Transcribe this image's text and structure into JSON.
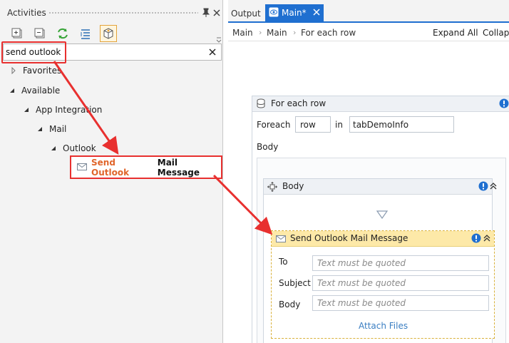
{
  "left_panel": {
    "title": "Activities",
    "search": {
      "value": "send outlook",
      "placeholder": ""
    },
    "tree": {
      "favorites": "Favorites",
      "available": "Available",
      "app_integration": "App Integration",
      "mail": "Mail",
      "outlook": "Outlook"
    },
    "result": {
      "highlight": "Send Outlook",
      "rest": "Mail Message",
      "icon": "mail-icon"
    }
  },
  "tabs": {
    "output": "Output",
    "main": "Main*"
  },
  "breadcrumb": {
    "items": [
      "Main",
      "Main",
      "For each row"
    ],
    "expand_all": "Expand All",
    "collapse_all": "Collapse All"
  },
  "designer": {
    "foreach": {
      "title": "For each row",
      "foreach_label": "Foreach",
      "var": "row",
      "in_label": "in",
      "collection": "tabDemoInfo",
      "body_label": "Body"
    },
    "body": {
      "title": "Body"
    },
    "mail": {
      "title": "Send Outlook Mail Message",
      "fields": [
        {
          "label": "To",
          "placeholder": "Text must be quoted"
        },
        {
          "label": "Subject",
          "placeholder": "Text must be quoted"
        },
        {
          "label": "Body",
          "placeholder": "Text must be quoted"
        }
      ],
      "attach": "Attach Files"
    }
  },
  "colors": {
    "accent": "#1f6fd0",
    "annotation": "#e8302f",
    "search_hit": "#e0652a",
    "activity_header": "#fde9a8",
    "link": "#3a7ec2"
  }
}
